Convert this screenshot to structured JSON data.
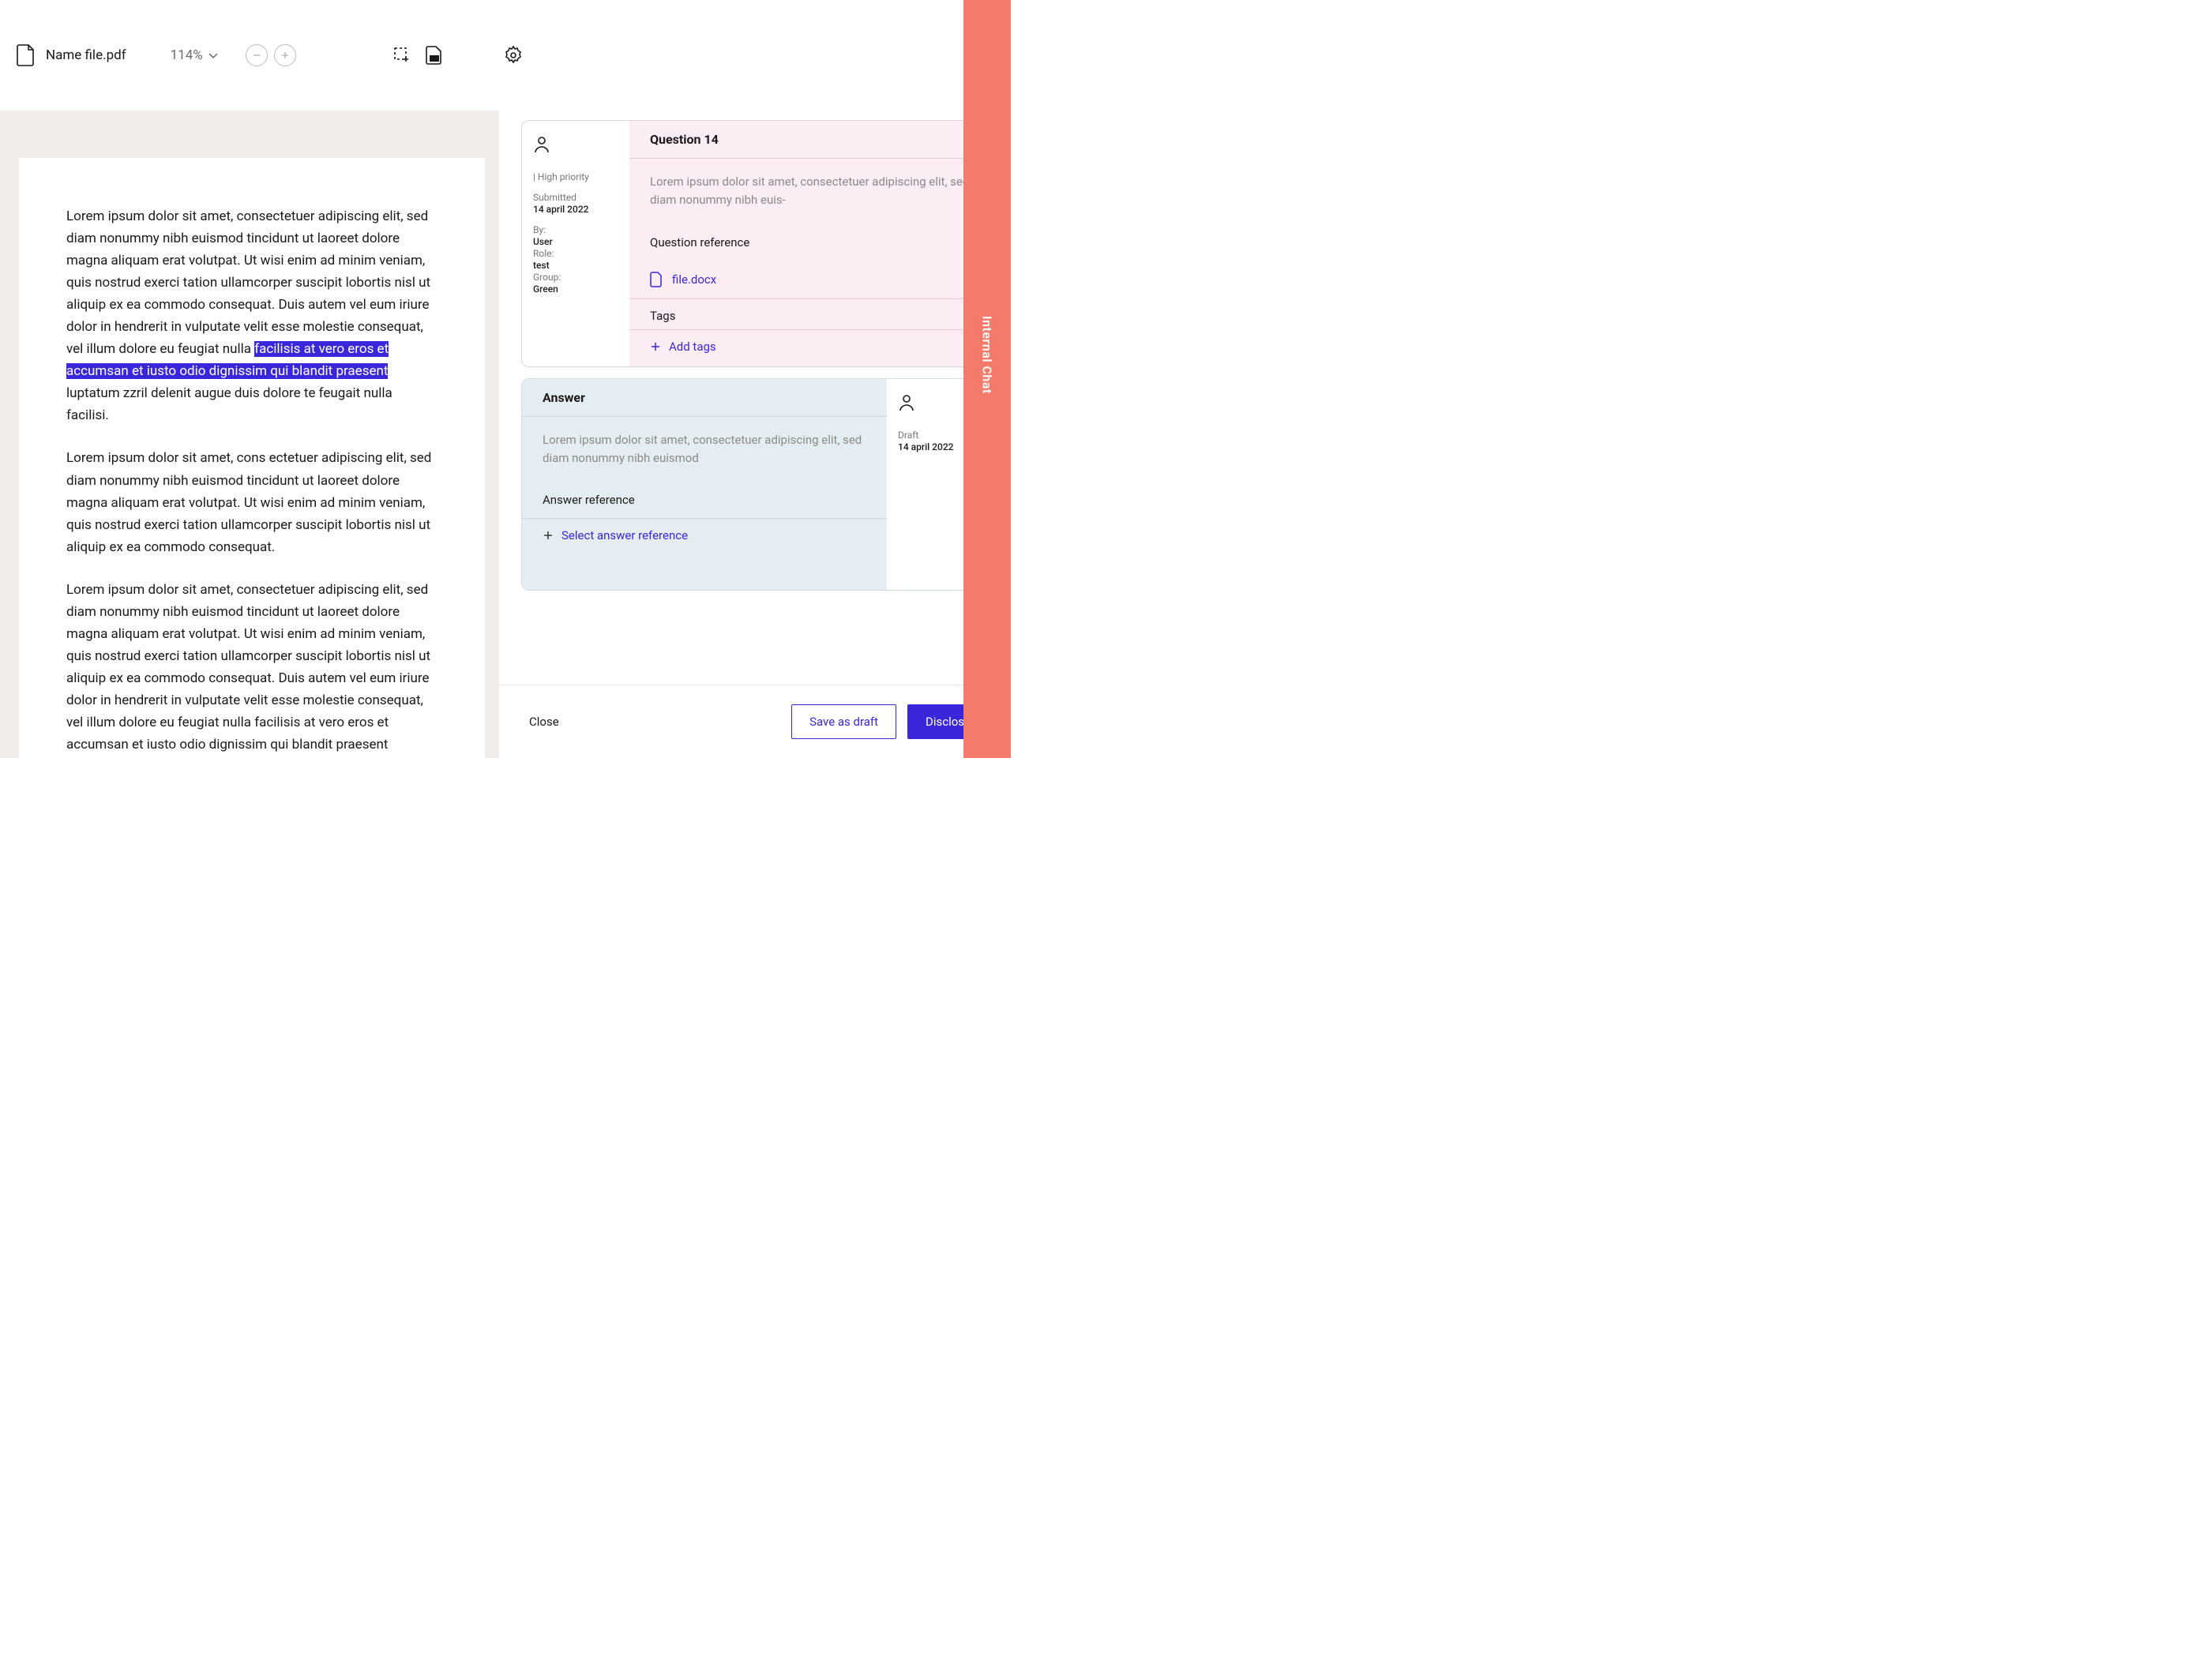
{
  "toolbar": {
    "file_name": "Name file.pdf",
    "zoom_level": "114%"
  },
  "document": {
    "para1_before_hl": "Lorem ipsum dolor sit amet, consectetuer adipiscing elit, sed diam nonummy nibh euismod tincidunt ut laoreet dolore magna aliquam erat volutpat. Ut wisi enim ad minim veniam, quis nostrud exerci tation ullamcorper suscipit lobortis nisl ut aliquip ex ea commodo consequat. Duis autem vel eum iriure dolor in hendrerit in vulputate velit esse molestie consequat, vel illum dolore eu feu­giat nulla ",
    "para1_hl": "facilisis at vero eros et accumsan et iusto odio dignis­sim qui blandit praesent",
    "para1_after_hl": " luptatum zzril delenit augue duis dolore te feugait nulla facilisi.",
    "para2": "Lorem ipsum dolor sit amet, cons ectetuer adipiscing elit, sed diam nonummy nibh euismod tincidunt ut laoreet dolore magna aliquam erat volutpat. Ut wisi enim ad minim veniam, quis nostrud exerci tation ullamcorper suscipit lobortis nisl ut aliquip ex ea commodo consequat.",
    "para3": "Lorem ipsum dolor sit amet, consectetuer adipiscing elit, sed diam nonummy nibh euismod tincidunt ut laoreet dolore magna aliquam erat volutpat. Ut wisi enim ad minim veniam, quis nostrud exerci tation ullamcorper suscipit lobortis nisl ut aliquip ex ea commodo consequat. Duis autem vel eum iriure dolor in hendrerit in vulputate velit esse molestie consequat, vel illum dolore eu feu­giat nulla facilisis at vero eros et accumsan et iusto odio dignis­sim qui blandit praesent luptatum zzril delenit augue duis dolore te feugait nulla facilisi."
  },
  "question": {
    "title": "Question 14",
    "text": "Lorem ipsum dolor sit amet, consectetuer adipiscing elit, sed diam nonummy nibh euis-",
    "ref_label": "Question reference",
    "ref_file": "file.docx",
    "tags_label": "Tags",
    "add_tags": "Add tags",
    "meta": {
      "priority": "| High priority",
      "submitted_label": "Submitted",
      "submitted_date": "14 april 2022",
      "by_label": "By:",
      "by": "User",
      "role_label": "Role:",
      "role": "test",
      "group_label": "Group:",
      "group": "Green"
    }
  },
  "answer": {
    "title": "Answer",
    "text": "Lorem ipsum dolor sit amet, consectetuer adip­iscing elit, sed diam nonummy nibh euismod",
    "ref_label": "Answer reference",
    "select_ref": "Select answer reference",
    "meta": {
      "draft_label": "Draft",
      "draft_date": "14 april 2022"
    }
  },
  "footer": {
    "close": "Close",
    "save_draft": "Save as draft",
    "disclose": "Disclose"
  },
  "chat_rail": {
    "label": "Internal Chat"
  }
}
